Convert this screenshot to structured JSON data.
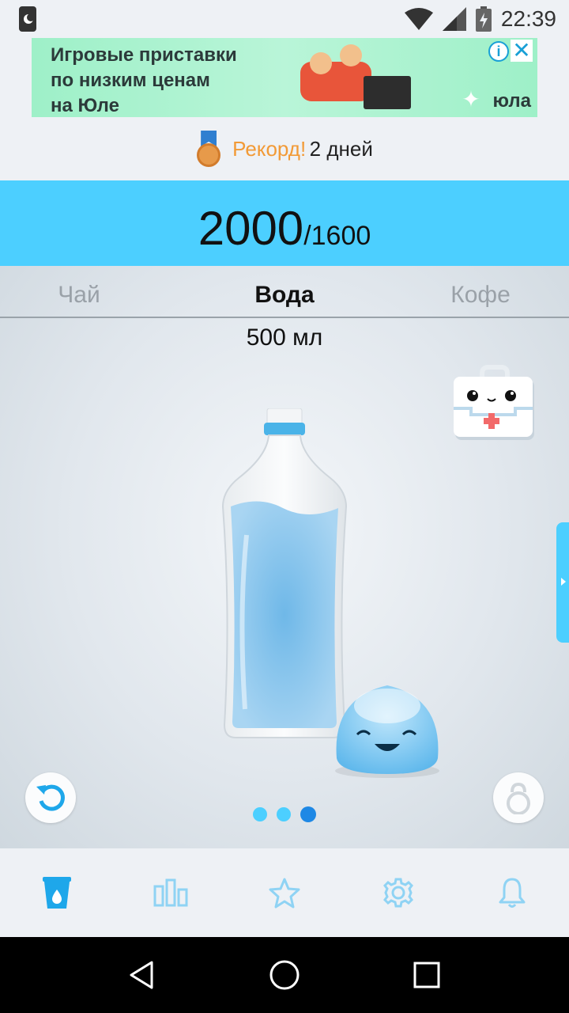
{
  "status_bar": {
    "time": "22:39"
  },
  "ad": {
    "text": "Игровые приставки\nпо низким ценам\nна Юле",
    "brand": "юла"
  },
  "record": {
    "label": "Рекорд!",
    "value": "2 дней"
  },
  "counter": {
    "current": "2000",
    "goal": "/1600"
  },
  "tabs": [
    {
      "label": "Чай",
      "active": false
    },
    {
      "label": "Вода",
      "active": true
    },
    {
      "label": "Кофе",
      "active": false
    }
  ],
  "volume": "500 мл",
  "bottle_fill_fraction": 0.7,
  "pager": {
    "count": 3,
    "active_index": 2
  },
  "bottom_nav": [
    "cup-icon",
    "stats-icon",
    "star-icon",
    "settings-icon",
    "bell-icon"
  ],
  "colors": {
    "accent": "#4ccfff",
    "accent_dark": "#1e88e5",
    "record": "#f29a36"
  }
}
